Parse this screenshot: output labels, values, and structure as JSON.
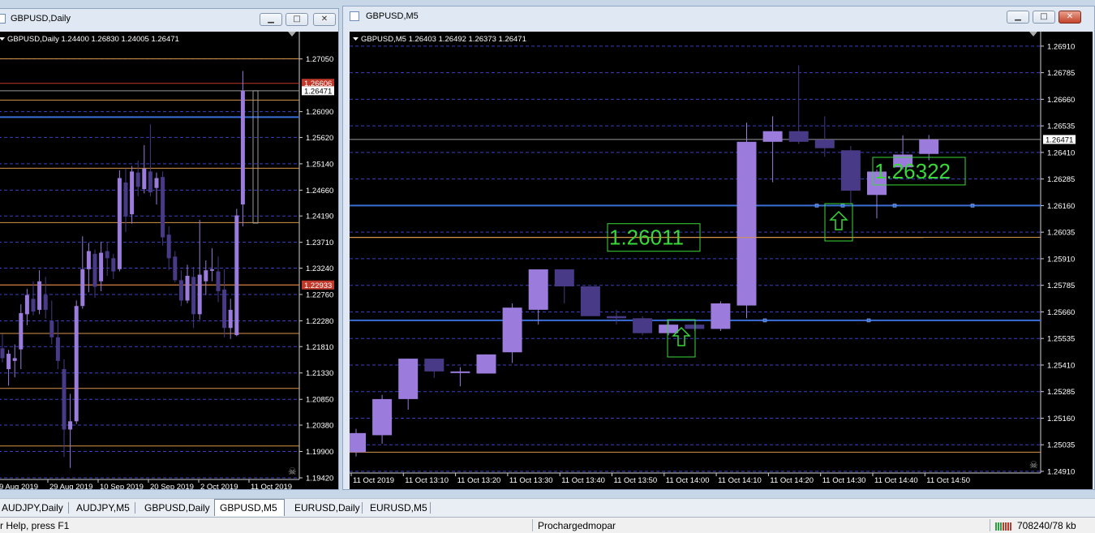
{
  "left_window": {
    "title": "GBPUSD,Daily",
    "chart_label": "GBPUSD,Daily  1.24400 1.26830 1.24005 1.26471",
    "price_labels": [
      "1.27050",
      "1.26090",
      "1.25620",
      "1.25140",
      "1.24660",
      "1.24190",
      "1.23710",
      "1.23240",
      "1.22760",
      "1.22280",
      "1.21810",
      "1.21330",
      "1.20850",
      "1.20380",
      "1.19900",
      "1.19420"
    ],
    "marker_red_top": "1.26606",
    "marker_current": "1.26471",
    "marker_red_mid": "1.22933",
    "date_labels": [
      "9 Aug 2019",
      "29 Aug 2019",
      "10 Sep 2019",
      "20 Sep 2019",
      "2 Oct 2019",
      "11 Oct 2019"
    ]
  },
  "right_window": {
    "title": "GBPUSD,M5",
    "chart_label": "GBPUSD,M5  1.26403 1.26492 1.26373 1.26471",
    "price_labels": [
      "1.26910",
      "1.26785",
      "1.26660",
      "1.26535",
      "1.26410",
      "1.26285",
      "1.26160",
      "1.26035",
      "1.25910",
      "1.25785",
      "1.25660",
      "1.25535",
      "1.25410",
      "1.25285",
      "1.25160",
      "1.25035",
      "1.24910"
    ],
    "marker_current": "1.26471",
    "annotation_left": "1.26011",
    "annotation_right": "1.26322",
    "time_labels": [
      "11 Oct 2019",
      "11 Oct 13:10",
      "11 Oct 13:20",
      "11 Oct 13:30",
      "11 Oct 13:40",
      "11 Oct 13:50",
      "11 Oct 14:00",
      "11 Oct 14:10",
      "11 Oct 14:20",
      "11 Oct 14:30",
      "11 Oct 14:40",
      "11 Oct 14:50"
    ]
  },
  "chart_data": [
    {
      "type": "candlestick",
      "symbol": "GBPUSD",
      "timeframe": "Daily",
      "ylim": [
        1.1942,
        1.2737
      ],
      "candles": [
        {
          "o": 1.2178,
          "h": 1.2204,
          "l": 1.2152,
          "c": 1.216
        },
        {
          "o": 1.214,
          "h": 1.2175,
          "l": 1.211,
          "c": 1.2168
        },
        {
          "o": 1.2155,
          "h": 1.2185,
          "l": 1.2125,
          "c": 1.216
        },
        {
          "o": 1.2176,
          "h": 1.2258,
          "l": 1.214,
          "c": 1.2242
        },
        {
          "o": 1.224,
          "h": 1.2286,
          "l": 1.222,
          "c": 1.2275
        },
        {
          "o": 1.2268,
          "h": 1.23,
          "l": 1.2238,
          "c": 1.2245
        },
        {
          "o": 1.2248,
          "h": 1.232,
          "l": 1.224,
          "c": 1.23
        },
        {
          "o": 1.2275,
          "h": 1.2308,
          "l": 1.2232,
          "c": 1.2248
        },
        {
          "o": 1.2228,
          "h": 1.2265,
          "l": 1.2185,
          "c": 1.2198
        },
        {
          "o": 1.2198,
          "h": 1.223,
          "l": 1.214,
          "c": 1.2155
        },
        {
          "o": 1.214,
          "h": 1.2158,
          "l": 1.198,
          "c": 1.203
        },
        {
          "o": 1.203,
          "h": 1.2095,
          "l": 1.196,
          "c": 1.2045
        },
        {
          "o": 1.2045,
          "h": 1.2265,
          "l": 1.204,
          "c": 1.2255
        },
        {
          "o": 1.2255,
          "h": 1.2382,
          "l": 1.225,
          "c": 1.2322
        },
        {
          "o": 1.2322,
          "h": 1.237,
          "l": 1.228,
          "c": 1.2355
        },
        {
          "o": 1.235,
          "h": 1.2358,
          "l": 1.227,
          "c": 1.229
        },
        {
          "o": 1.23,
          "h": 1.2372,
          "l": 1.2282,
          "c": 1.2352
        },
        {
          "o": 1.2355,
          "h": 1.2372,
          "l": 1.231,
          "c": 1.2342
        },
        {
          "o": 1.2342,
          "h": 1.235,
          "l": 1.2304,
          "c": 1.2318
        },
        {
          "o": 1.2322,
          "h": 1.2502,
          "l": 1.2318,
          "c": 1.2488
        },
        {
          "o": 1.248,
          "h": 1.2506,
          "l": 1.239,
          "c": 1.2418
        },
        {
          "o": 1.2422,
          "h": 1.251,
          "l": 1.2405,
          "c": 1.25
        },
        {
          "o": 1.2498,
          "h": 1.252,
          "l": 1.2455,
          "c": 1.2472
        },
        {
          "o": 1.2468,
          "h": 1.2548,
          "l": 1.246,
          "c": 1.2505
        },
        {
          "o": 1.25,
          "h": 1.2586,
          "l": 1.2455,
          "c": 1.2462
        },
        {
          "o": 1.247,
          "h": 1.2498,
          "l": 1.244,
          "c": 1.2488
        },
        {
          "o": 1.249,
          "h": 1.25,
          "l": 1.2365,
          "c": 1.238
        },
        {
          "o": 1.2385,
          "h": 1.24,
          "l": 1.232,
          "c": 1.2342
        },
        {
          "o": 1.2345,
          "h": 1.2355,
          "l": 1.2298,
          "c": 1.2302
        },
        {
          "o": 1.2302,
          "h": 1.232,
          "l": 1.2255,
          "c": 1.2265
        },
        {
          "o": 1.2265,
          "h": 1.233,
          "l": 1.226,
          "c": 1.231
        },
        {
          "o": 1.2308,
          "h": 1.2326,
          "l": 1.2215,
          "c": 1.224
        },
        {
          "o": 1.224,
          "h": 1.2412,
          "l": 1.223,
          "c": 1.2312
        },
        {
          "o": 1.23,
          "h": 1.2338,
          "l": 1.2275,
          "c": 1.232
        },
        {
          "o": 1.2322,
          "h": 1.236,
          "l": 1.23,
          "c": 1.2322
        },
        {
          "o": 1.2318,
          "h": 1.2345,
          "l": 1.2262,
          "c": 1.2282
        },
        {
          "o": 1.2285,
          "h": 1.2322,
          "l": 1.2198,
          "c": 1.2215
        },
        {
          "o": 1.2215,
          "h": 1.2268,
          "l": 1.2195,
          "c": 1.2248
        },
        {
          "o": 1.2202,
          "h": 1.2432,
          "l": 1.22,
          "c": 1.242
        },
        {
          "o": 1.244,
          "h": 1.2683,
          "l": 1.24,
          "c": 1.2647
        }
      ],
      "horizontal_lines": [
        {
          "price": 1.27053,
          "color": "#d8944a"
        },
        {
          "price": 1.26606,
          "color": "#c0392b"
        },
        {
          "price": 1.26471,
          "color": "#9a9a9a"
        },
        {
          "price": 1.263,
          "color": "#d8944a"
        },
        {
          "price": 1.2599,
          "color": "#3b6fd8"
        },
        {
          "price": 1.2506,
          "color": "#d8944a"
        },
        {
          "price": 1.2407,
          "color": "#d8944a"
        },
        {
          "price": 1.22933,
          "color": "#c0392b"
        },
        {
          "price": 1.22933,
          "color": "#d8944a"
        },
        {
          "price": 1.2205,
          "color": "#d8944a"
        },
        {
          "price": 1.2105,
          "color": "#d8944a"
        },
        {
          "price": 1.2,
          "color": "#d8944a"
        }
      ]
    },
    {
      "type": "candlestick",
      "symbol": "GBPUSD",
      "timeframe": "M5",
      "ylim": [
        1.2491,
        1.2694
      ],
      "candles": [
        {
          "o": 1.25,
          "h": 1.2511,
          "l": 1.2498,
          "c": 1.2509
        },
        {
          "o": 1.2508,
          "h": 1.2527,
          "l": 1.2504,
          "c": 1.2525
        },
        {
          "o": 1.2525,
          "h": 1.2544,
          "l": 1.252,
          "c": 1.2544
        },
        {
          "o": 1.2544,
          "h": 1.2544,
          "l": 1.2535,
          "c": 1.2538
        },
        {
          "o": 1.2538,
          "h": 1.254,
          "l": 1.2531,
          "c": 1.2538
        },
        {
          "o": 1.2537,
          "h": 1.2546,
          "l": 1.2537,
          "c": 1.2546
        },
        {
          "o": 1.2547,
          "h": 1.257,
          "l": 1.2542,
          "c": 1.2568
        },
        {
          "o": 1.2567,
          "h": 1.2586,
          "l": 1.256,
          "c": 1.2586
        },
        {
          "o": 1.2586,
          "h": 1.2586,
          "l": 1.257,
          "c": 1.2578
        },
        {
          "o": 1.2578,
          "h": 1.2578,
          "l": 1.2564,
          "c": 1.2564
        },
        {
          "o": 1.2564,
          "h": 1.2567,
          "l": 1.256,
          "c": 1.2563
        },
        {
          "o": 1.2563,
          "h": 1.2564,
          "l": 1.2555,
          "c": 1.2556
        },
        {
          "o": 1.2556,
          "h": 1.2562,
          "l": 1.2555,
          "c": 1.256
        },
        {
          "o": 1.256,
          "h": 1.2561,
          "l": 1.2557,
          "c": 1.2558
        },
        {
          "o": 1.2558,
          "h": 1.2571,
          "l": 1.2557,
          "c": 1.257
        },
        {
          "o": 1.2569,
          "h": 1.2655,
          "l": 1.2563,
          "c": 1.2646
        },
        {
          "o": 1.2646,
          "h": 1.2658,
          "l": 1.2627,
          "c": 1.2651
        },
        {
          "o": 1.2651,
          "h": 1.2682,
          "l": 1.2645,
          "c": 1.2646
        },
        {
          "o": 1.2647,
          "h": 1.2658,
          "l": 1.2639,
          "c": 1.2643
        },
        {
          "o": 1.2642,
          "h": 1.2644,
          "l": 1.2616,
          "c": 1.2623
        },
        {
          "o": 1.2621,
          "h": 1.2633,
          "l": 1.261,
          "c": 1.2632
        },
        {
          "o": 1.2634,
          "h": 1.2649,
          "l": 1.2633,
          "c": 1.264
        },
        {
          "o": 1.26403,
          "h": 1.26492,
          "l": 1.26373,
          "c": 1.26471
        }
      ],
      "horizontal_lines": [
        {
          "price": 1.26471,
          "color": "#9a9a9a"
        },
        {
          "price": 1.2616,
          "color": "#3b6fd8"
        },
        {
          "price": 1.26011,
          "color": "#d8944a"
        },
        {
          "price": 1.2562,
          "color": "#3b6fd8"
        },
        {
          "price": 1.25,
          "color": "#d8944a"
        }
      ]
    }
  ],
  "tabs": [
    {
      "label": "AUDJPY,Daily",
      "active": false
    },
    {
      "label": "AUDJPY,M5",
      "active": false
    },
    {
      "label": "GBPUSD,Daily",
      "active": false
    },
    {
      "label": "GBPUSD,M5",
      "active": true
    },
    {
      "label": "EURUSD,Daily",
      "active": false
    },
    {
      "label": "EURUSD,M5",
      "active": false
    }
  ],
  "status": {
    "help": "r Help, press F1",
    "profile": "Prochargedmopar",
    "traffic": "708240/78 kb"
  },
  "colors": {
    "bull": "#9b7bdc",
    "bear": "#483a86",
    "grid": "#3b3fbf",
    "annotation": "#39d839"
  }
}
